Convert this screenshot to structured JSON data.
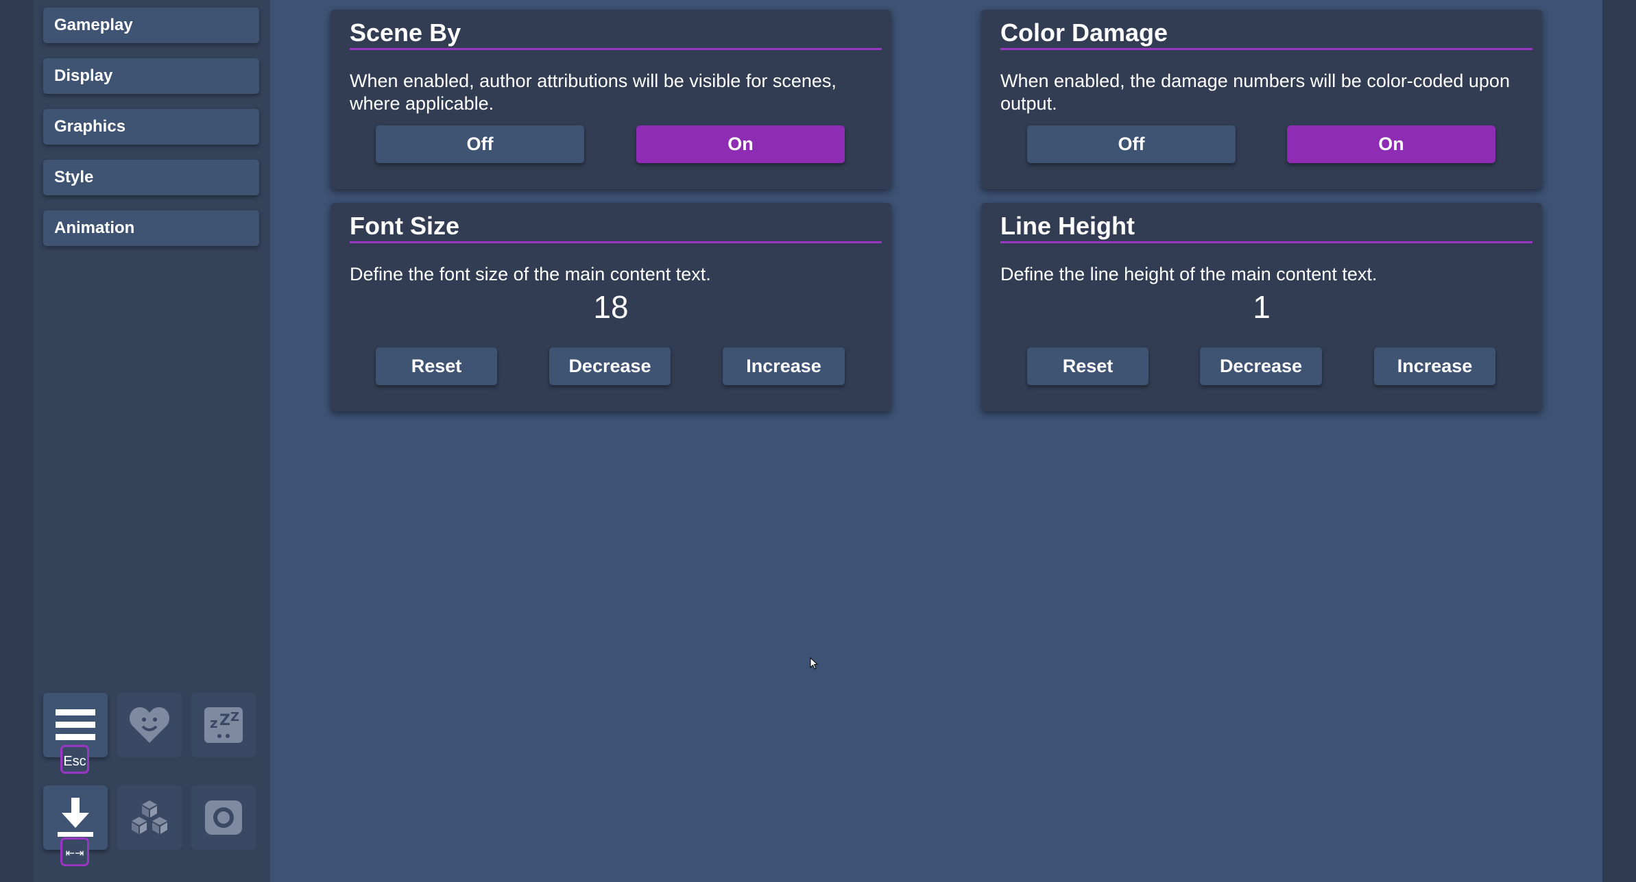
{
  "sidebar": {
    "items": [
      {
        "label": "Gameplay"
      },
      {
        "label": "Display"
      },
      {
        "label": "Graphics"
      },
      {
        "label": "Style"
      },
      {
        "label": "Animation"
      }
    ],
    "tools": {
      "menu_key": "Esc",
      "save_key": "⇤⇥",
      "icons": [
        "menu-icon",
        "heart-icon",
        "sleep-icon",
        "download-icon",
        "cubes-icon",
        "screenshot-icon"
      ]
    }
  },
  "panels": {
    "scene_by": {
      "title": "Scene By",
      "description": "When enabled, author attributions will be visible for scenes, where applicable.",
      "off_label": "Off",
      "on_label": "On",
      "selected": "On"
    },
    "color_damage": {
      "title": "Color Damage",
      "description": "When enabled, the damage numbers will be color-coded upon output.",
      "off_label": "Off",
      "on_label": "On",
      "selected": "On"
    },
    "font_size": {
      "title": "Font Size",
      "description": "Define the font size of the main content text.",
      "value": "18",
      "reset_label": "Reset",
      "decrease_label": "Decrease",
      "increase_label": "Increase"
    },
    "line_height": {
      "title": "Line Height",
      "description": "Define the line height of the main content text.",
      "value": "1",
      "reset_label": "Reset",
      "decrease_label": "Decrease",
      "increase_label": "Increase"
    }
  },
  "colors": {
    "accent": "#8e2db4",
    "background": "#3d5274",
    "panel": "#323d53",
    "button": "#3f5373"
  }
}
